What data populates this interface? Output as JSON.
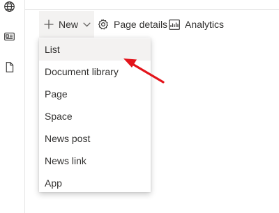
{
  "left_rail": {
    "icons": [
      "globe-icon",
      "news-card-icon",
      "document-icon"
    ]
  },
  "command_bar": {
    "new_label": "New",
    "page_details_label": "Page details",
    "analytics_label": "Analytics"
  },
  "new_menu": {
    "items": [
      "List",
      "Document library",
      "Page",
      "Space",
      "News post",
      "News link",
      "App"
    ],
    "highlighted": "List"
  },
  "annotation": {
    "arrow_color": "#e3141b",
    "points_to": "List"
  }
}
